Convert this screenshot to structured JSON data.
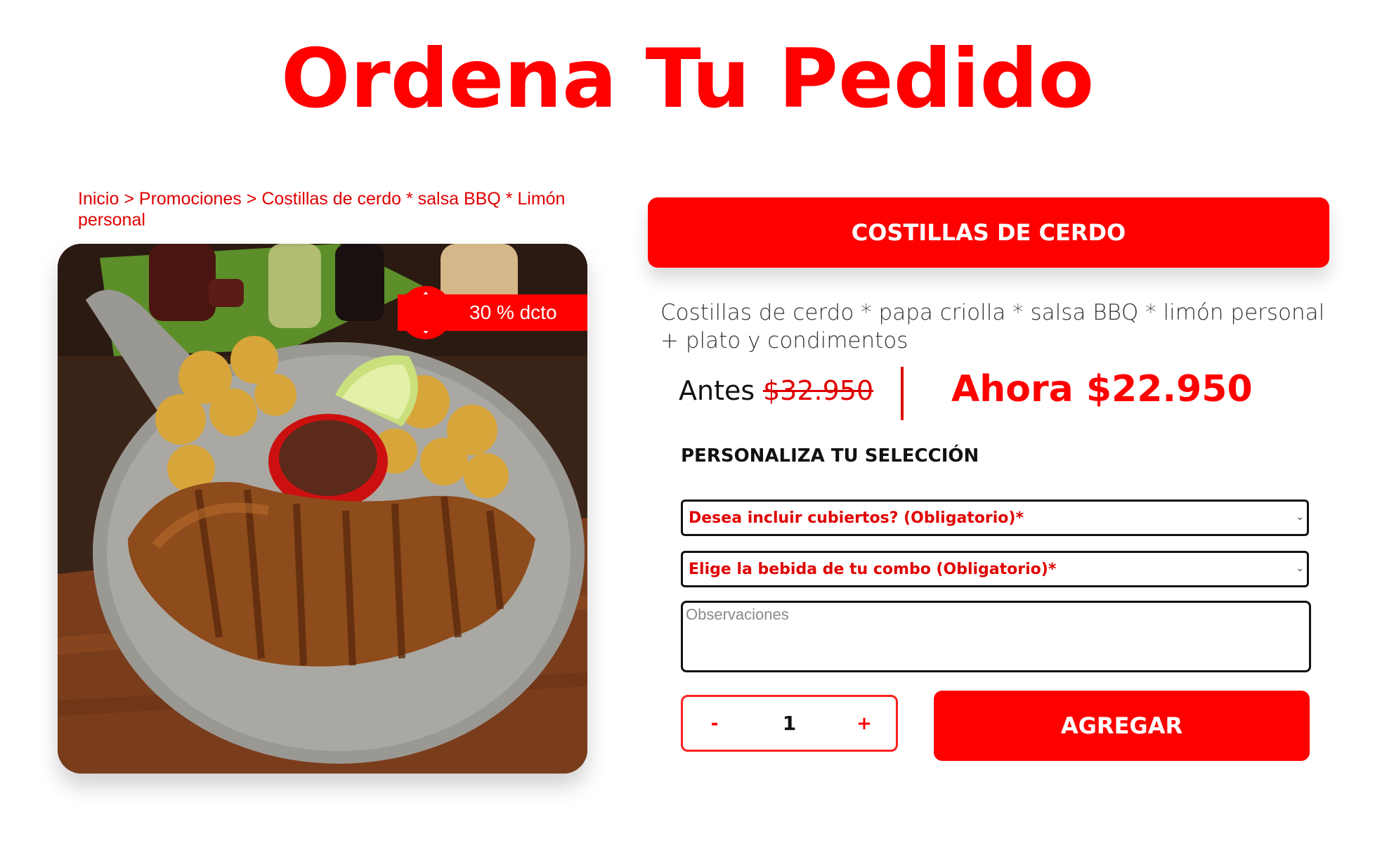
{
  "page": {
    "title": "Ordena Tu Pedido"
  },
  "breadcrumb": {
    "items": [
      "Inicio",
      "Promociones",
      "Costillas de cerdo * salsa BBQ * Limón personal"
    ],
    "separator": ">"
  },
  "product": {
    "badge": "30 % dcto",
    "badge_icon": "percent-badge-icon",
    "name": "COSTILLAS DE CERDO",
    "description": "Costillas de cerdo * papa criolla * salsa BBQ * limón personal + plato y condimentos",
    "price_before_label": "Antes",
    "price_before_value": "$32.950",
    "price_now": "Ahora $22.950"
  },
  "customize": {
    "heading": "PERSONALIZA TU SELECCIÓN",
    "cutlery_select": "Desea incluir cubiertos? (Obligatorio)*",
    "drink_select": "Elige la bebida de tu combo (Obligatorio)*",
    "notes_placeholder": "Observaciones"
  },
  "cart": {
    "decrement_label": "-",
    "quantity": "1",
    "increment_label": "+",
    "add_label": "AGREGAR"
  },
  "colors": {
    "brand_red": "#ff0000",
    "text_dark": "#111111"
  }
}
